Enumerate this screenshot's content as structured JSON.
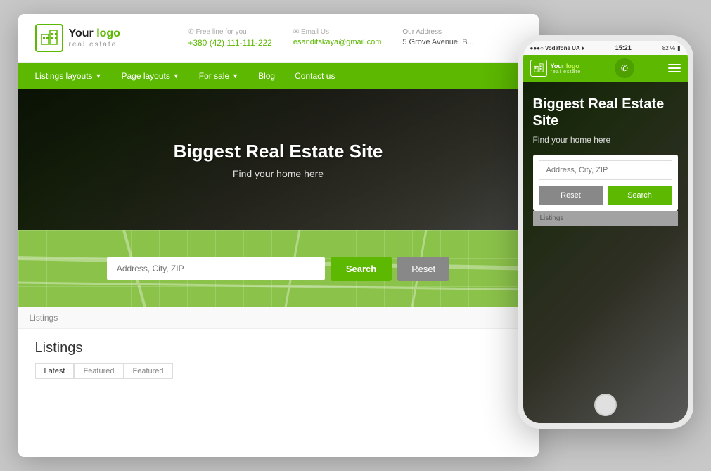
{
  "desktop": {
    "logo": {
      "brand_plain": "Your ",
      "brand_colored": "logo",
      "tagline": "real estate"
    },
    "contacts": [
      {
        "label": "Free line for you",
        "icon": "phone-icon",
        "value": "+380 (42) 111-111-222"
      },
      {
        "label": "Email Us",
        "icon": "email-icon",
        "value": "esanditskaya@gmail.com"
      },
      {
        "label": "Our Address",
        "icon": "address-icon",
        "value": "5 Grove Avenue, B..."
      }
    ],
    "nav": {
      "items": [
        {
          "label": "Listings layouts",
          "has_arrow": true
        },
        {
          "label": "Page layouts",
          "has_arrow": true
        },
        {
          "label": "For sale",
          "has_arrow": true
        },
        {
          "label": "Blog",
          "has_arrow": false
        },
        {
          "label": "Contact us",
          "has_arrow": false
        }
      ]
    },
    "hero": {
      "title": "Biggest Real Estate Site",
      "subtitle": "Find your home here"
    },
    "search": {
      "placeholder": "Address, City, ZIP",
      "search_label": "Search",
      "reset_label": "Reset"
    },
    "listings_nav_label": "Listings",
    "listings_section": {
      "title": "Listings",
      "tabs": [
        "Latest",
        "Featured",
        "Featured"
      ]
    }
  },
  "mobile": {
    "status_bar": {
      "left": "●●●○ Vodafone UA ♦",
      "center": "15:21",
      "right": "82 %"
    },
    "logo": {
      "brand_plain": "Your ",
      "brand_colored": "logo",
      "tagline": "real estate"
    },
    "hero": {
      "title": "Biggest Real Estate Site",
      "subtitle": "Find your home here"
    },
    "search": {
      "placeholder": "Address, City, ZIP",
      "search_label": "Search",
      "reset_label": "Reset"
    },
    "listings_label": "Listings"
  },
  "colors": {
    "green": "#5cb800",
    "green_light": "#8bc34a",
    "gray": "#888888",
    "white": "#ffffff"
  }
}
